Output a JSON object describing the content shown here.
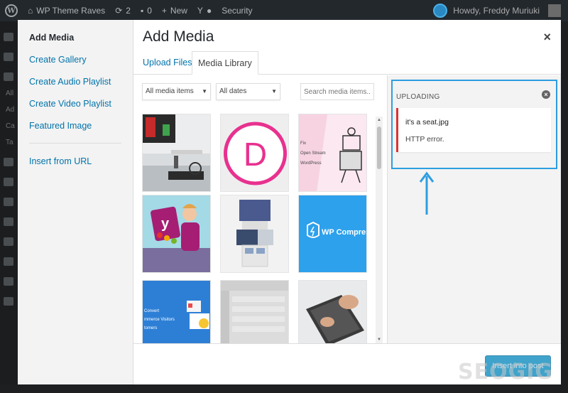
{
  "admin_bar": {
    "site_name": "WP Theme Raves",
    "updates_count": "2",
    "comments_count": "0",
    "new_label": "New",
    "security_label": "Security",
    "greeting": "Howdy, Freddy Muriuki"
  },
  "wp_sidebar": {
    "texts": [
      "All",
      "Ad",
      "Ca",
      "Ta"
    ]
  },
  "modal": {
    "title": "Add Media",
    "close_symbol": "×",
    "menu": {
      "items": [
        {
          "label": "Add Media"
        },
        {
          "label": "Create Gallery"
        },
        {
          "label": "Create Audio Playlist"
        },
        {
          "label": "Create Video Playlist"
        },
        {
          "label": "Featured Image"
        },
        {
          "label": "Insert from URL"
        }
      ]
    },
    "tabs": [
      {
        "label": "Upload Files"
      },
      {
        "label": "Media Library"
      }
    ],
    "filters": {
      "type_selected": "All media items",
      "date_selected": "All dates",
      "search_placeholder": "Search media items..."
    },
    "thumbnails": [
      {
        "name": "desk-computer-photo"
      },
      {
        "name": "divi-logo",
        "text": "D"
      },
      {
        "name": "open-stream-illustration",
        "lines": [
          "Fix",
          "Open Stream",
          "WordPress"
        ]
      },
      {
        "name": "yoast-illustration"
      },
      {
        "name": "mobile-screens"
      },
      {
        "name": "wp-compress-graphic",
        "text": "WP Compress"
      },
      {
        "name": "convert-visitors-graphic",
        "lines": [
          "Convert",
          "mmerce Visitors",
          "tomers"
        ]
      },
      {
        "name": "dashboard-screenshot"
      },
      {
        "name": "laptop-typing-photo"
      }
    ],
    "uploading": {
      "title": "Uploading",
      "file_name": "it's a seat.jpg",
      "error": "HTTP error."
    },
    "footer": {
      "insert_label": "Insert into post"
    }
  },
  "watermark": "SEOGIG",
  "colors": {
    "accent": "#0073aa",
    "highlight_box": "#2c9ee0",
    "error": "#dc3232",
    "divi_pink": "#e8318f",
    "wp_compress_blue": "#2da1ec"
  }
}
